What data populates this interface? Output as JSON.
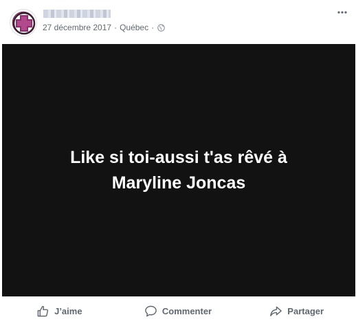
{
  "post": {
    "author_name": "",
    "date": "27 décembre 2017",
    "separator": "·",
    "location": "Québec",
    "visibility_icon": "globe-icon",
    "menu_icon": "more-options-icon",
    "caption": "Like si toi-aussi t'as rêvé à Maryline Joncas"
  },
  "actions": {
    "like_label": "J’aime",
    "comment_label": "Commenter",
    "share_label": "Partager"
  },
  "colors": {
    "media_background": "#121212",
    "caption_text": "#ffffff",
    "meta_text": "#616770",
    "action_text": "#606770",
    "avatar_accent": "#7a2d5c"
  }
}
